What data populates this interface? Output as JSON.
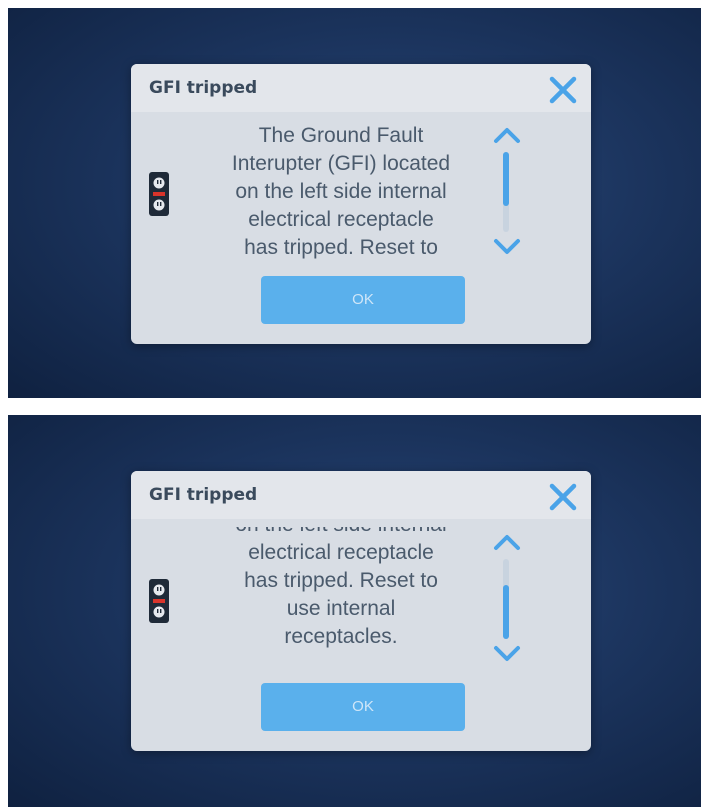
{
  "dialog": {
    "title": "GFI tripped",
    "ok_label": "OK",
    "close_icon": "close-icon",
    "device_icon": "electrical-outlet-icon",
    "accent_color": "#4aa3e8"
  },
  "screen1": {
    "message_lines": [
      "The Ground Fault",
      "Interupter (GFI) located",
      "on the left side internal",
      "electrical receptacle",
      "has tripped. Reset to"
    ]
  },
  "screen2": {
    "message_lines": [
      "on the left side internal",
      "electrical receptacle",
      "has tripped. Reset to",
      "use internal",
      "receptacles."
    ]
  }
}
